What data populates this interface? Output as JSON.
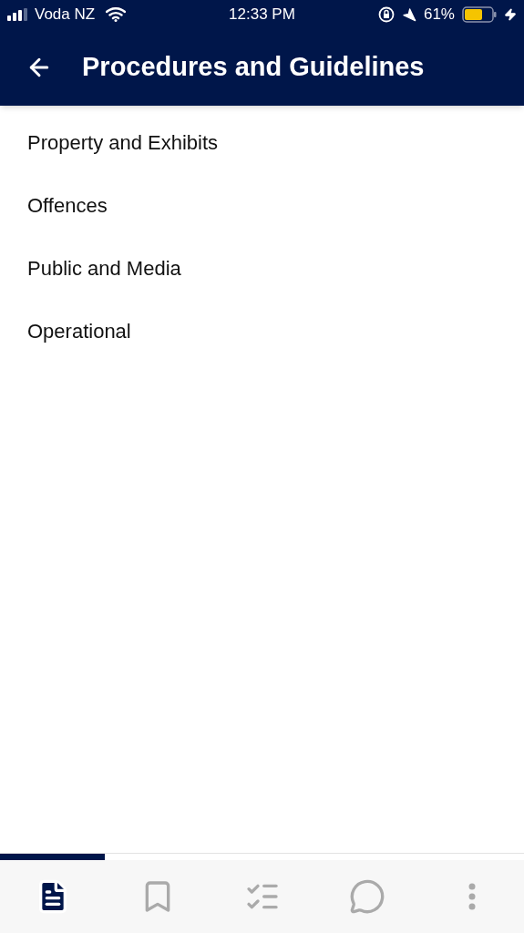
{
  "status_bar": {
    "carrier": "Voda NZ",
    "time": "12:33 PM",
    "battery": "61%"
  },
  "header": {
    "title": "Procedures and Guidelines"
  },
  "items": [
    "Property and Exhibits",
    "Offences",
    "Public and Media",
    "Operational"
  ],
  "progress": {
    "level": 0.2
  },
  "nav_tabs": [
    {
      "kind": "document",
      "selected": true
    },
    {
      "kind": "bookmark",
      "selected": false
    },
    {
      "kind": "checklist",
      "selected": false
    },
    {
      "kind": "chat",
      "selected": false
    },
    {
      "kind": "more",
      "selected": false
    }
  ]
}
